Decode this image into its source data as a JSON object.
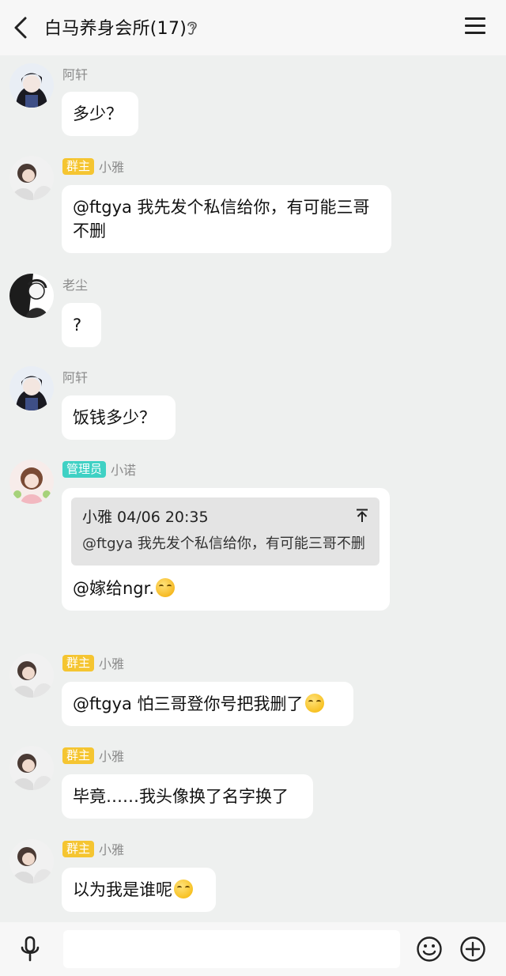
{
  "header": {
    "title": "白马养身会所(17)"
  },
  "messages": [
    {
      "name": "阿轩",
      "text": "多少？"
    },
    {
      "badge": "群主",
      "name": "小雅",
      "text": "@ftgya 我先发个私信给你，有可能三哥不删"
    },
    {
      "name": "老尘",
      "text": "?"
    },
    {
      "name": "阿轩",
      "text": "饭钱多少？"
    },
    {
      "badge": "管理员",
      "name": "小诺",
      "quote": {
        "head": "小雅 04/06 20:35",
        "body": "@ftgya 我先发个私信给你，有可能三哥不删"
      },
      "text": "@嫁给ngr."
    },
    {
      "badge": "群主",
      "name": "小雅",
      "text": "@ftgya 怕三哥登你号把我删了"
    },
    {
      "badge": "群主",
      "name": "小雅",
      "text": "毕竟……我头像换了名字换了"
    },
    {
      "badge": "群主",
      "name": "小雅",
      "text": "以为我是谁呢"
    }
  ],
  "input": {
    "placeholder": ""
  },
  "icons": {
    "back": "chevron-left-icon",
    "ear": "ear-icon",
    "menu": "hamburger-menu-icon",
    "mic": "microphone-icon",
    "emoji": "smiley-icon",
    "plus": "plus-circle-icon"
  },
  "colors": {
    "background": "#eef0ef",
    "bubble": "#ffffff",
    "owner_badge": "#f5c531",
    "admin_badge": "#3fd1c4",
    "name_text": "#8b8b8b"
  }
}
